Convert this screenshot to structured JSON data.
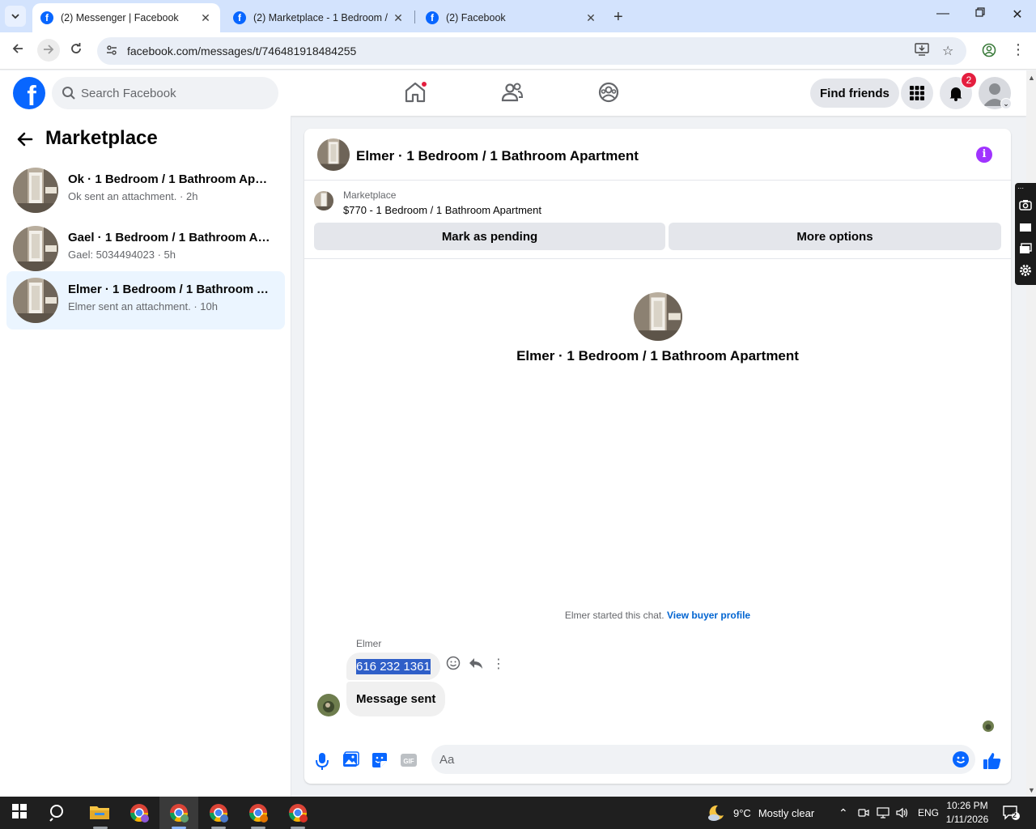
{
  "browser": {
    "tabs": [
      {
        "title": "(2) Messenger | Facebook",
        "active": true
      },
      {
        "title": "(2) Marketplace - 1 Bedroom /",
        "active": false
      },
      {
        "title": "(2) Facebook",
        "active": false
      }
    ],
    "url": "facebook.com/messages/t/746481918484255"
  },
  "fb_header": {
    "search_placeholder": "Search Facebook",
    "find_friends_label": "Find friends",
    "notification_count": "2"
  },
  "left_panel": {
    "title": "Marketplace",
    "conversations": [
      {
        "name": "Ok · 1 Bedroom / 1 Bathroom Apartment",
        "snippet": "Ok sent an attachment. · 2h",
        "selected": false
      },
      {
        "name": "Gael · 1 Bedroom / 1 Bathroom Apartment",
        "snippet": "Gael: 5034494023 · 5h",
        "selected": false
      },
      {
        "name": "Elmer · 1 Bedroom / 1 Bathroom Apartment",
        "snippet": "Elmer sent an attachment. · 10h",
        "selected": true
      }
    ]
  },
  "chat": {
    "title": "Elmer · 1 Bedroom / 1 Bathroom Apartment",
    "marketplace_label": "Marketplace",
    "listing": "$770 - 1 Bedroom / 1 Bathroom Apartment",
    "mark_pending_label": "Mark as pending",
    "more_options_label": "More options",
    "center_title": "Elmer · 1 Bedroom / 1 Bathroom Apartment",
    "started_text": "Elmer started this chat.",
    "buyer_profile_link": "View buyer profile",
    "sender_name": "Elmer",
    "messages": [
      {
        "text": "616 232 1361",
        "highlighted": true
      },
      {
        "text": "Message sent",
        "highlighted": false
      }
    ],
    "composer_placeholder": "Aa"
  },
  "taskbar": {
    "weather_temp": "9°C",
    "weather_text": "Mostly clear",
    "language": "ENG",
    "time": "10:26 PM",
    "date": "1/11/2026",
    "notification_count": "2"
  },
  "colors": {
    "fb_blue": "#0866ff",
    "badge_red": "#e41e3f",
    "info_purple": "#a033ff",
    "selected_conv": "#ebf5ff",
    "highlight": "#2f5fc8"
  }
}
